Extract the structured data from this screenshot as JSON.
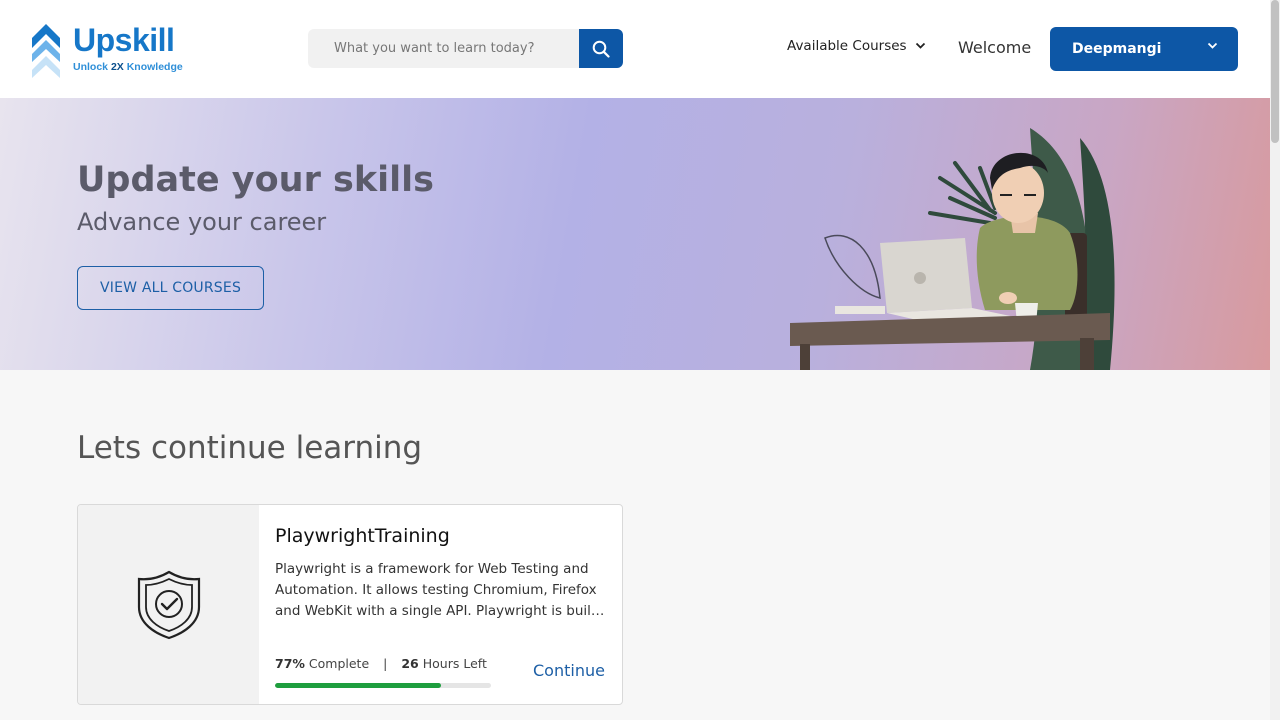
{
  "header": {
    "logo_text": "Upskill",
    "logo_tagline_pre": "Unlock ",
    "logo_tagline_bold": "2X",
    "logo_tagline_post": " Knowledge",
    "search_placeholder": "What you want to learn today?",
    "search_value": "",
    "search_icon": "search-icon",
    "nav_courses": "Available Courses",
    "welcome": "Welcome",
    "user_name": "Deepmangi",
    "brand_color": "#0d57a6"
  },
  "hero": {
    "title": "Update your skills",
    "subtitle": "Advance your career",
    "button": "VIEW ALL COURSES"
  },
  "learning": {
    "section_title": "Lets continue learning",
    "courses": [
      {
        "title": "PlaywrightTraining",
        "description": "Playwright is a framework for Web Testing and Automation. It allows testing Chromium, Firefox and WebKit with a single API. Playwright is built to enable cross-browser web automation.",
        "percent_label": "77%",
        "complete_label": "Complete",
        "hours_label": "26",
        "hours_suffix": "Hours Left",
        "progress": 0.77,
        "progress_color": "#1e9e3e",
        "action": "Continue",
        "icon": "certificate-shield-icon"
      }
    ]
  }
}
